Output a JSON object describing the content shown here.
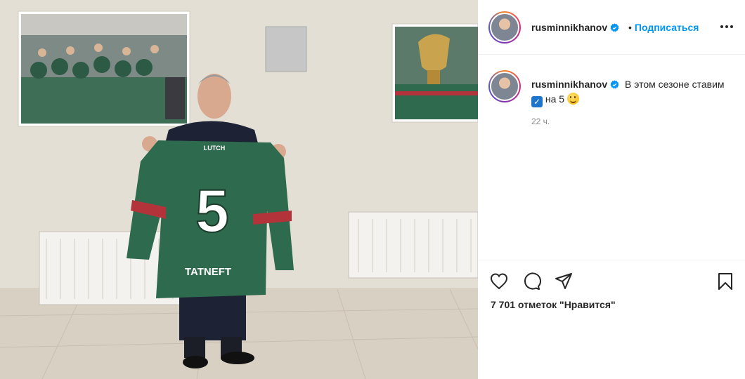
{
  "post": {
    "image_alt": "Photo of a man holding a green hockey jersey number 5",
    "jersey": {
      "brand": "LUTCH",
      "number": "5",
      "sponsor": "TATNEFT"
    }
  },
  "header": {
    "username": "rusminnikhanov",
    "follow_label": "Подписаться",
    "separator": "•",
    "more_icon": "more-horizontal-icon",
    "verified_icon": "verified-badge-icon"
  },
  "caption": {
    "username": "rusminnikhanov",
    "text_before": "В этом сезоне ставим",
    "check_emoji": "✓",
    "text_after": "на 5",
    "time": "22 ч."
  },
  "actions": {
    "icons": [
      "heart-icon",
      "comment-icon",
      "share-icon",
      "bookmark-icon"
    ],
    "likes": "7 701 отметок \"Нравится\""
  },
  "colors": {
    "accent": "#0095f6",
    "text": "#262626",
    "muted": "#8e8e8e",
    "jersey": "#2e6a4d"
  }
}
